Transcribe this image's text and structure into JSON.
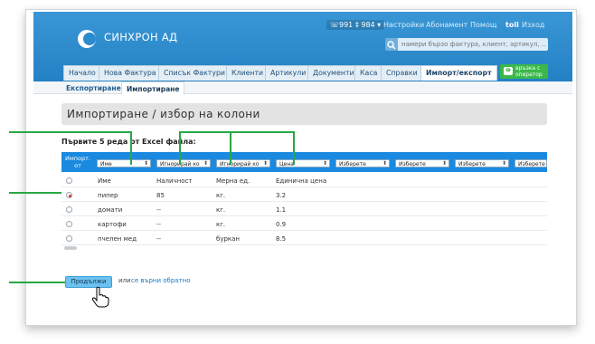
{
  "app": {
    "brand": "СИНХРОН АД"
  },
  "top": {
    "phone": "☏991 ‡ 984 ▾",
    "links": [
      "Настройки",
      "Абонамент",
      "Помощ"
    ],
    "user": "toli",
    "logout": "Изход"
  },
  "search": {
    "placeholder": "намери бързо фактура, клиент, артикул, ..."
  },
  "nav": {
    "tabs": [
      "Начало",
      "Нова Фактура",
      "Списък Фактури",
      "Клиенти",
      "Артикули",
      "Документи",
      "Каса",
      "Справки",
      "Импорт/експорт"
    ],
    "active": "Импорт/експорт",
    "chat_label": "връзка с оператор"
  },
  "subnav": {
    "tabs": [
      "Експортиране",
      "Импортиране"
    ],
    "active": "Импортиране"
  },
  "page": {
    "title": "Импортиране / избор на колони",
    "subheading": "Първите 5 реда от Excel файла:"
  },
  "table": {
    "import_label": "Импорт. от",
    "column_selects": [
      "Име",
      "Игнорирай ко",
      "Игнорирай ко",
      "Цена",
      "Изберете",
      "Изберете",
      "Изберете",
      "Изберете"
    ],
    "rows": [
      {
        "selected": false,
        "cells": [
          "Име",
          "Наличност",
          "Мерна ед.",
          "Единична цена"
        ]
      },
      {
        "selected": true,
        "cells": [
          "пипер",
          "85",
          "кг.",
          "3.2"
        ]
      },
      {
        "selected": false,
        "cells": [
          "домати",
          "--",
          "кг.",
          "1.1"
        ]
      },
      {
        "selected": false,
        "cells": [
          "картофи",
          "--",
          "кг.",
          "0.9"
        ]
      },
      {
        "selected": false,
        "cells": [
          "пчелен мед",
          "--",
          "буркан",
          "8.5"
        ]
      }
    ]
  },
  "actions": {
    "continue_label": "Продължи",
    "or_text": "или",
    "back_link": "се върни обратно"
  },
  "colors": {
    "header_blue": "#2381c4",
    "table_header": "#1a8ae0",
    "annotation_green": "#28a745",
    "button": "#6cc1ef"
  }
}
